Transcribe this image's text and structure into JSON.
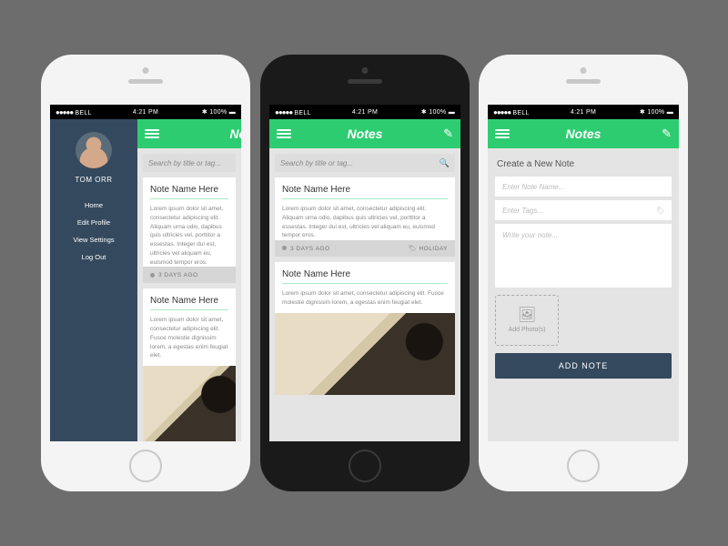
{
  "status": {
    "carrier": "BELL",
    "time": "4:21 PM",
    "battery": "100%",
    "signal": "●●●●●",
    "bt": "⚡"
  },
  "app": {
    "title": "Notes",
    "title_frag": "No"
  },
  "sidebar": {
    "username": "TOM ORR",
    "items": [
      {
        "label": "Home"
      },
      {
        "label": "Edit Profile"
      },
      {
        "label": "View Settings"
      },
      {
        "label": "Log Out"
      }
    ]
  },
  "search": {
    "placeholder": "Search by title or tag..."
  },
  "notes": [
    {
      "title": "Note Name Here",
      "body": "Lorem ipsum dolor sit amet, consectetur adipiscing elit. Aliquam urna odio, dapibus quis ultricies vel, porttitor a essestas. Integer dui est, ultricies vel aliquam eu, euismod tempor eros.",
      "time": "3 DAYS AGO",
      "tag": "HOLIDAY"
    },
    {
      "title": "Note Name Here",
      "body": "Lorem ipsum dolor sit amet, consectetur adipiscing elit. Fusce molestie dignissim lorem, a egestas enim feugiat elet."
    }
  ],
  "create": {
    "heading": "Create a New Note",
    "name_ph": "Enter Note Name...",
    "tags_ph": "Enter Tags...",
    "body_ph": "Write your note...",
    "addphoto": "Add Photo(s)",
    "submit": "ADD NOTE"
  }
}
